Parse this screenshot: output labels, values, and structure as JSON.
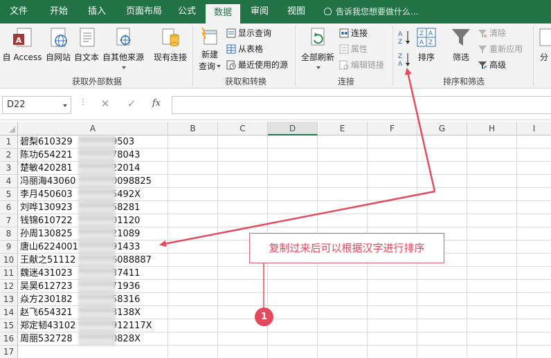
{
  "tabs": [
    "文件",
    "开始",
    "插入",
    "页面布局",
    "公式",
    "数据",
    "审阅",
    "视图"
  ],
  "active_tab": "数据",
  "tell_me": "告诉我您想要做什么...",
  "ribbon": {
    "get_external": {
      "label": "获取外部数据",
      "buttons": [
        "自 Access",
        "自网站",
        "自文本",
        "自其他来源",
        "现有连接"
      ]
    },
    "get_transform": {
      "label": "获取和转换",
      "new_query": [
        "新建",
        "查询"
      ],
      "show_query": "显示查询",
      "from_table": "从表格",
      "recent_sources": "最近使用的源"
    },
    "connections": {
      "label": "连接",
      "refresh_all": "全部刷新",
      "connections": "连接",
      "properties": "属性",
      "edit_links": "编辑链接"
    },
    "sort_filter": {
      "label": "排序和筛选",
      "sort": "排序",
      "filter": "筛选",
      "clear": "清除",
      "reapply": "重新应用",
      "advanced": "高级"
    },
    "more": "分"
  },
  "formula_bar": {
    "name_box": "D22",
    "fx": "fx",
    "cancel": "✕",
    "enter": "✓",
    "dots": "⋮",
    "value": ""
  },
  "columns": [
    "A",
    "B",
    "C",
    "D",
    "E",
    "F",
    "G",
    "H",
    "I"
  ],
  "selected_column": "D",
  "rows": [
    {
      "n": "1",
      "a": "碧梨610329",
      "b": "9503"
    },
    {
      "n": "2",
      "a": "陈功654221",
      "b": "78043"
    },
    {
      "n": "3",
      "a": "楚敏420281",
      "b": "22014"
    },
    {
      "n": "4",
      "a": "冯丽海43060",
      "b": "0098825"
    },
    {
      "n": "5",
      "a": "李月450603",
      "b": "5492X"
    },
    {
      "n": "6",
      "a": "刘哗130923",
      "b": "58281"
    },
    {
      "n": "7",
      "a": "钱锦610722",
      "b": "01120"
    },
    {
      "n": "8",
      "a": "孙周130825",
      "b": "21089"
    },
    {
      "n": "9",
      "a": "唐山6224001",
      "b": "91433"
    },
    {
      "n": "10",
      "a": "王献之51112",
      "b": "6088887"
    },
    {
      "n": "11",
      "a": "魏迷431023",
      "b": "37411"
    },
    {
      "n": "12",
      "a": "吴昊612723",
      "b": "71936"
    },
    {
      "n": "13",
      "a": "焱方230182",
      "b": "58316"
    },
    {
      "n": "14",
      "a": "赵飞654321",
      "b": "3138X"
    },
    {
      "n": "15",
      "a": "郑定韧43102",
      "b": "912117X"
    },
    {
      "n": "16",
      "a": "周丽532728",
      "b": "0828X"
    },
    {
      "n": "17",
      "a": "",
      "b": ""
    }
  ],
  "annotation": {
    "text": "复制过来后可以根据汉字进行排序",
    "badge": "1"
  },
  "colors": {
    "excel_green": "#217346",
    "annotation_red": "#e5495e"
  }
}
